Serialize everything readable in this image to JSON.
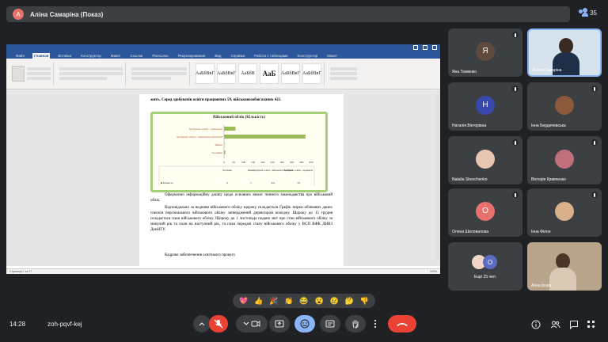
{
  "topbar": {
    "presenter_initial": "А",
    "presenter_label": "Аліна Самаріна (Показ)",
    "participant_count": "35"
  },
  "word": {
    "title": "",
    "tabs": [
      "Файл",
      "Главная",
      "Вставка",
      "Конструктор",
      "Макет",
      "Ссылки",
      "Рассылки",
      "Рецензирование",
      "Вид",
      "Справка",
      "Работа с таблицами",
      "Конструктор",
      "Макет"
    ],
    "active_tab_index": 1,
    "styles": [
      "АаБбВвГ",
      "АаБбВвГ",
      "АаБбВ",
      "АаБ",
      "АаБбВвГ",
      "АаБбВвГ"
    ],
    "doc_line_top": "жить. Серед здобувачів освіти працюючих   59, військовозобов'язаних   421.",
    "chart": {
      "title": "Військовий облік (Кількість)",
      "xticks": [
        "0",
        "50",
        "100",
        "150",
        "200",
        "250",
        "300",
        "350",
        "400",
        "450"
      ]
    },
    "paragraph1": "Оформлено інформаційну дошку щодо основних вимог чинного законодавства про військовий облік.",
    "paragraph2": "Відповідально за ведення військового обліку щороку складається Графік звірки облікових даних списків персонального військового обліку затверджений директором коледжу. Щороку до 15 грудня складається план військового обліку. Щороку до 1 листопада подано звіт про стан військового обліку за минулий рік та план на наступний рік, та план передачі стану військового обліку у ВСП ВФК ДНВЗ ДонНТУ.",
    "heading": "Кадрове забезпечення освітнього процесу",
    "status_left": "Страница 1 из 17",
    "status_right": "100%"
  },
  "chart_data": {
    "type": "bar",
    "title": "Військовий облік (Кількість)",
    "categories": [
      "Чоловіки",
      "Жінки",
      "Здобувачі освіти - військовозобов'язані",
      "Здобувачі освіти - працюючі"
    ],
    "values": [
      6,
      1,
      421,
      59
    ],
    "xlim": [
      0,
      450
    ],
    "table_headers": [
      "Чоловіки",
      "Жінки",
      "Здобувачі освіти - військовозобов'язані",
      "Здобувачі освіти - працюючі"
    ],
    "table_row_label": "Кількість",
    "table_values": [
      "6",
      "1",
      "421",
      "59"
    ]
  },
  "participants": [
    {
      "name": "Яна Тюменко",
      "initial": "Я",
      "color": "#5f4a3d",
      "type": "avatar",
      "muted": true
    },
    {
      "name": "Аліна Самаріна",
      "type": "video",
      "muted": false
    },
    {
      "name": "Наталія Вікторівна",
      "initial": "Н",
      "color": "#3949ab",
      "type": "avatar",
      "muted": true
    },
    {
      "name": "Інна Бердичевська",
      "type": "photo",
      "photo_color": "#8b5a3c",
      "muted": true
    },
    {
      "name": "Natalia Shevchenko",
      "type": "photo",
      "photo_color": "#e8c6b0",
      "muted": true
    },
    {
      "name": "Вікторія Кравченко",
      "type": "photo",
      "photo_color": "#c0707a",
      "muted": true
    },
    {
      "name": "Олена Шиловалова",
      "initial": "О",
      "color": "#e8716d",
      "type": "avatar",
      "muted": true
    },
    {
      "name": "Інна Філон",
      "type": "photo",
      "photo_color": "#d9b08c",
      "muted": true
    },
    {
      "name": "Ещё 25 чел.",
      "type": "more",
      "initial": "О"
    },
    {
      "name": "Анна Ірова",
      "type": "video2",
      "muted": false
    }
  ],
  "reactions": [
    "💖",
    "👍",
    "🎉",
    "👏",
    "😂",
    "😮",
    "😢",
    "🤔",
    "👎"
  ],
  "bottom": {
    "time": "14:28",
    "code": "zoh-pqvf-kej"
  }
}
